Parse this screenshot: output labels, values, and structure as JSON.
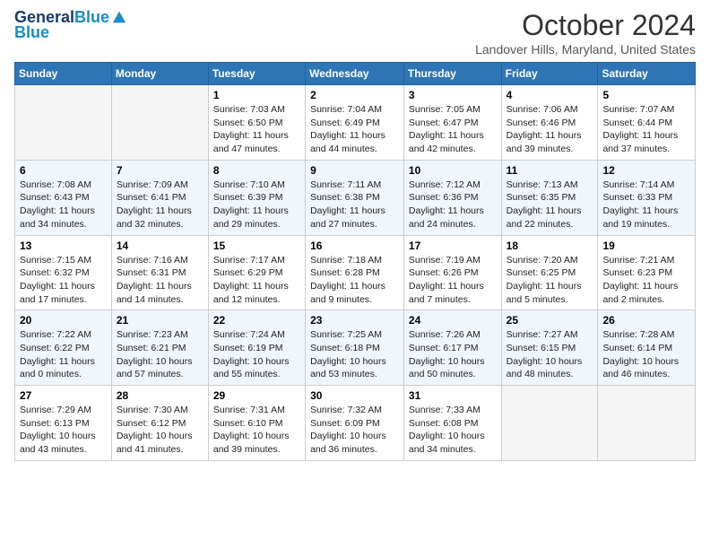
{
  "header": {
    "logo_line1": "General",
    "logo_line2": "Blue",
    "month": "October 2024",
    "location": "Landover Hills, Maryland, United States"
  },
  "weekdays": [
    "Sunday",
    "Monday",
    "Tuesday",
    "Wednesday",
    "Thursday",
    "Friday",
    "Saturday"
  ],
  "weeks": [
    [
      {
        "day": "",
        "info": ""
      },
      {
        "day": "",
        "info": ""
      },
      {
        "day": "1",
        "info": "Sunrise: 7:03 AM\nSunset: 6:50 PM\nDaylight: 11 hours and 47 minutes."
      },
      {
        "day": "2",
        "info": "Sunrise: 7:04 AM\nSunset: 6:49 PM\nDaylight: 11 hours and 44 minutes."
      },
      {
        "day": "3",
        "info": "Sunrise: 7:05 AM\nSunset: 6:47 PM\nDaylight: 11 hours and 42 minutes."
      },
      {
        "day": "4",
        "info": "Sunrise: 7:06 AM\nSunset: 6:46 PM\nDaylight: 11 hours and 39 minutes."
      },
      {
        "day": "5",
        "info": "Sunrise: 7:07 AM\nSunset: 6:44 PM\nDaylight: 11 hours and 37 minutes."
      }
    ],
    [
      {
        "day": "6",
        "info": "Sunrise: 7:08 AM\nSunset: 6:43 PM\nDaylight: 11 hours and 34 minutes."
      },
      {
        "day": "7",
        "info": "Sunrise: 7:09 AM\nSunset: 6:41 PM\nDaylight: 11 hours and 32 minutes."
      },
      {
        "day": "8",
        "info": "Sunrise: 7:10 AM\nSunset: 6:39 PM\nDaylight: 11 hours and 29 minutes."
      },
      {
        "day": "9",
        "info": "Sunrise: 7:11 AM\nSunset: 6:38 PM\nDaylight: 11 hours and 27 minutes."
      },
      {
        "day": "10",
        "info": "Sunrise: 7:12 AM\nSunset: 6:36 PM\nDaylight: 11 hours and 24 minutes."
      },
      {
        "day": "11",
        "info": "Sunrise: 7:13 AM\nSunset: 6:35 PM\nDaylight: 11 hours and 22 minutes."
      },
      {
        "day": "12",
        "info": "Sunrise: 7:14 AM\nSunset: 6:33 PM\nDaylight: 11 hours and 19 minutes."
      }
    ],
    [
      {
        "day": "13",
        "info": "Sunrise: 7:15 AM\nSunset: 6:32 PM\nDaylight: 11 hours and 17 minutes."
      },
      {
        "day": "14",
        "info": "Sunrise: 7:16 AM\nSunset: 6:31 PM\nDaylight: 11 hours and 14 minutes."
      },
      {
        "day": "15",
        "info": "Sunrise: 7:17 AM\nSunset: 6:29 PM\nDaylight: 11 hours and 12 minutes."
      },
      {
        "day": "16",
        "info": "Sunrise: 7:18 AM\nSunset: 6:28 PM\nDaylight: 11 hours and 9 minutes."
      },
      {
        "day": "17",
        "info": "Sunrise: 7:19 AM\nSunset: 6:26 PM\nDaylight: 11 hours and 7 minutes."
      },
      {
        "day": "18",
        "info": "Sunrise: 7:20 AM\nSunset: 6:25 PM\nDaylight: 11 hours and 5 minutes."
      },
      {
        "day": "19",
        "info": "Sunrise: 7:21 AM\nSunset: 6:23 PM\nDaylight: 11 hours and 2 minutes."
      }
    ],
    [
      {
        "day": "20",
        "info": "Sunrise: 7:22 AM\nSunset: 6:22 PM\nDaylight: 11 hours and 0 minutes."
      },
      {
        "day": "21",
        "info": "Sunrise: 7:23 AM\nSunset: 6:21 PM\nDaylight: 10 hours and 57 minutes."
      },
      {
        "day": "22",
        "info": "Sunrise: 7:24 AM\nSunset: 6:19 PM\nDaylight: 10 hours and 55 minutes."
      },
      {
        "day": "23",
        "info": "Sunrise: 7:25 AM\nSunset: 6:18 PM\nDaylight: 10 hours and 53 minutes."
      },
      {
        "day": "24",
        "info": "Sunrise: 7:26 AM\nSunset: 6:17 PM\nDaylight: 10 hours and 50 minutes."
      },
      {
        "day": "25",
        "info": "Sunrise: 7:27 AM\nSunset: 6:15 PM\nDaylight: 10 hours and 48 minutes."
      },
      {
        "day": "26",
        "info": "Sunrise: 7:28 AM\nSunset: 6:14 PM\nDaylight: 10 hours and 46 minutes."
      }
    ],
    [
      {
        "day": "27",
        "info": "Sunrise: 7:29 AM\nSunset: 6:13 PM\nDaylight: 10 hours and 43 minutes."
      },
      {
        "day": "28",
        "info": "Sunrise: 7:30 AM\nSunset: 6:12 PM\nDaylight: 10 hours and 41 minutes."
      },
      {
        "day": "29",
        "info": "Sunrise: 7:31 AM\nSunset: 6:10 PM\nDaylight: 10 hours and 39 minutes."
      },
      {
        "day": "30",
        "info": "Sunrise: 7:32 AM\nSunset: 6:09 PM\nDaylight: 10 hours and 36 minutes."
      },
      {
        "day": "31",
        "info": "Sunrise: 7:33 AM\nSunset: 6:08 PM\nDaylight: 10 hours and 34 minutes."
      },
      {
        "day": "",
        "info": ""
      },
      {
        "day": "",
        "info": ""
      }
    ]
  ]
}
